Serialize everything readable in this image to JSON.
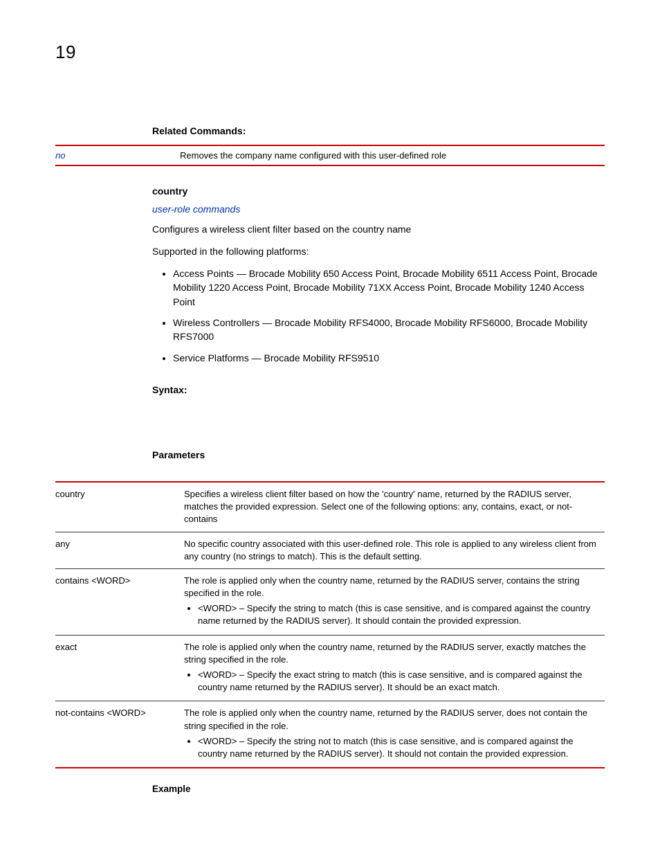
{
  "page_number": "19",
  "headings": {
    "related_commands": "Related Commands:",
    "country": "country",
    "syntax": "Syntax:",
    "parameters": "Parameters",
    "example": "Example"
  },
  "related_commands_row": {
    "key": "no",
    "desc": "Removes the company name configured with this user-defined role"
  },
  "link_text": "user-role commands",
  "intro": "Configures a wireless client filter based on the country name",
  "supported": "Supported in the following platforms:",
  "bullets": {
    "b1": "Access Points — Brocade Mobility 650 Access Point, Brocade Mobility 6511 Access Point, Brocade Mobility 1220 Access Point, Brocade Mobility 71XX Access Point, Brocade Mobility 1240 Access Point",
    "b2": "Wireless Controllers — Brocade Mobility RFS4000, Brocade Mobility RFS6000, Brocade Mobility RFS7000",
    "b3": "Service Platforms — Brocade Mobility RFS9510"
  },
  "params": {
    "r1k": "country",
    "r1v": "Specifies a wireless client filter based on how the 'country' name, returned by the RADIUS server, matches the provided expression. Select one of the following options: any, contains, exact, or not-contains",
    "r2k": "any",
    "r2v": "No specific country associated with this user-defined role. This role is applied to any wireless client from any country (no strings to match). This is the default setting.",
    "r3k": "contains <WORD>",
    "r3v": "The role is applied only when the country name, returned by the RADIUS server, contains the string specified in the role.",
    "r3b": "<WORD> – Specify the string to match (this is case sensitive, and is compared against the country name returned by the RADIUS server). It should contain the provided expression.",
    "r4k": "exact",
    "r4v": "The role is applied only when the country name, returned by the RADIUS server, exactly matches the string specified in the role.",
    "r4b": "<WORD> – Specify the exact string to match (this is case sensitive, and is compared against the country name returned by the RADIUS server). It should be an exact match.",
    "r5k": "not-contains <WORD>",
    "r5v": "The role is applied only when the country name, returned by the RADIUS server, does not contain the string specified in the role.",
    "r5b": "<WORD> – Specify the string not to match (this is case sensitive, and is compared against the country name returned by the RADIUS server). It should not contain the provided expression."
  }
}
